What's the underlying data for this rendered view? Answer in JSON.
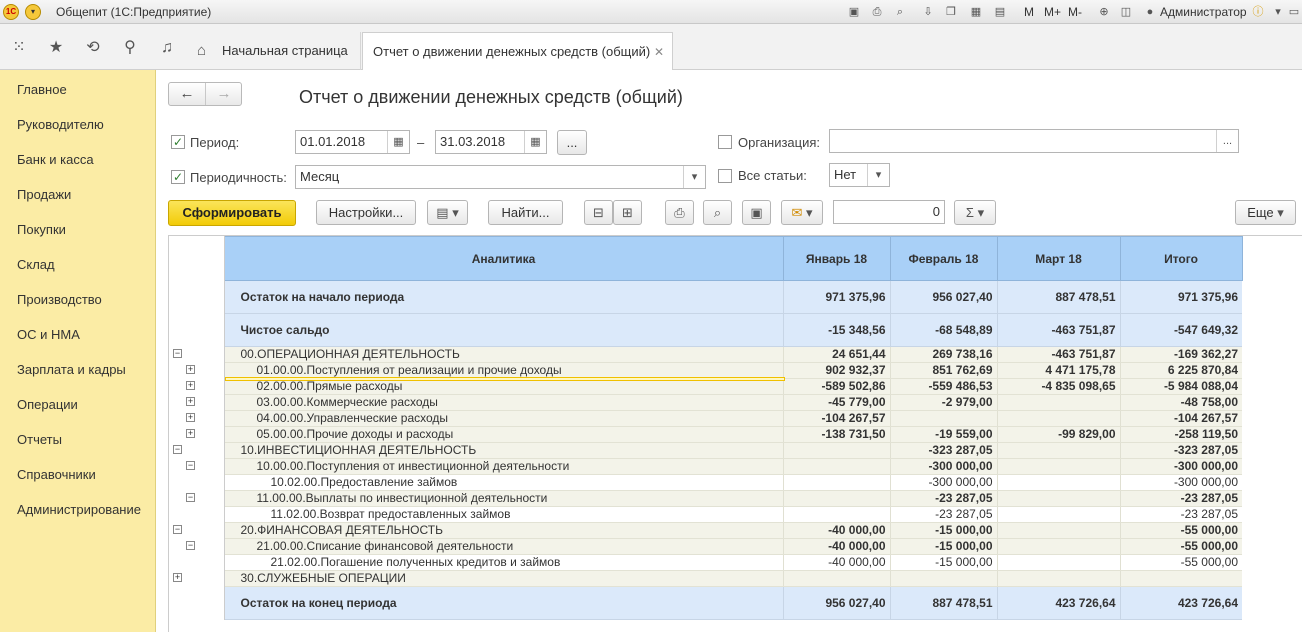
{
  "window": {
    "title": "Общепит  (1С:Предприятие)",
    "user": "Администратор",
    "toolbar_text": [
      "M",
      "M+",
      "M-"
    ]
  },
  "tabs": {
    "home": "Начальная страница",
    "active": "Отчет о движении денежных средств (общий)"
  },
  "sidebar": {
    "items": [
      "Главное",
      "Руководителю",
      "Банк и касса",
      "Продажи",
      "Покупки",
      "Склад",
      "Производство",
      "ОС и НМА",
      "Зарплата и кадры",
      "Операции",
      "Отчеты",
      "Справочники",
      "Администрирование"
    ]
  },
  "page": {
    "title": "Отчет о движении денежных средств (общий)"
  },
  "filters": {
    "period_label": "Период:",
    "period_from": "01.01.2018",
    "dash": "–",
    "period_to": "31.03.2018",
    "dots": "...",
    "periodicity_label": "Периодичность:",
    "periodicity_value": "Месяц",
    "org_label": "Организация:",
    "org_value": "",
    "all_items_label": "Все статьи:",
    "all_items_value": "Нет"
  },
  "buttons": {
    "generate": "Сформировать",
    "settings": "Настройки...",
    "find": "Найти...",
    "sum_value": "0",
    "more": "Еще"
  },
  "colors": {
    "sidebar_bg": "#fbeca5",
    "header_bg": "#a9d0f7",
    "total_bg": "#dbe9fa",
    "row_bg": "#f3f3e9",
    "generate_button": "#f2cb07"
  },
  "report": {
    "headers": [
      "Аналитика",
      "Январь 18",
      "Февраль 18",
      "Март 18",
      "Итого"
    ],
    "rows": [
      {
        "label": "Остаток на начало периода",
        "v": [
          "971 375,96",
          "956 027,40",
          "887 478,51",
          "971 375,96"
        ]
      },
      {
        "label": "Чистое сальдо",
        "v": [
          "-15 348,56",
          "-68 548,89",
          "-463 751,87",
          "-547 649,32"
        ]
      },
      {
        "label": "00.ОПЕРАЦИОННАЯ ДЕЯТЕЛЬНОСТЬ",
        "v": [
          "24 651,44",
          "269 738,16",
          "-463 751,87",
          "-169 362,27"
        ]
      },
      {
        "label": "01.00.00.Поступления от реализации и прочие доходы",
        "v": [
          "902 932,37",
          "851 762,69",
          "4 471 175,78",
          "6 225 870,84"
        ]
      },
      {
        "label": "02.00.00.Прямые расходы",
        "v": [
          "-589 502,86",
          "-559 486,53",
          "-4 835 098,65",
          "-5 984 088,04"
        ]
      },
      {
        "label": "03.00.00.Коммерческие расходы",
        "v": [
          "-45 779,00",
          "-2 979,00",
          "",
          "-48 758,00"
        ]
      },
      {
        "label": "04.00.00.Управленческие расходы",
        "v": [
          "-104 267,57",
          "",
          "",
          "-104 267,57"
        ]
      },
      {
        "label": "05.00.00.Прочие доходы и расходы",
        "v": [
          "-138 731,50",
          "-19 559,00",
          "-99 829,00",
          "-258 119,50"
        ]
      },
      {
        "label": "10.ИНВЕСТИЦИОННАЯ ДЕЯТЕЛЬНОСТЬ",
        "v": [
          "",
          "-323 287,05",
          "",
          "-323 287,05"
        ]
      },
      {
        "label": "10.00.00.Поступления от инвестиционной деятельности",
        "v": [
          "",
          "-300 000,00",
          "",
          "-300 000,00"
        ]
      },
      {
        "label": "10.02.00.Предоставление займов",
        "v": [
          "",
          "-300 000,00",
          "",
          "-300 000,00"
        ]
      },
      {
        "label": "11.00.00.Выплаты по инвестиционной деятельности",
        "v": [
          "",
          "-23 287,05",
          "",
          "-23 287,05"
        ]
      },
      {
        "label": "11.02.00.Возврат предоставленных займов",
        "v": [
          "",
          "-23 287,05",
          "",
          "-23 287,05"
        ]
      },
      {
        "label": "20.ФИНАНСОВАЯ ДЕЯТЕЛЬНОСТЬ",
        "v": [
          "-40 000,00",
          "-15 000,00",
          "",
          "-55 000,00"
        ]
      },
      {
        "label": "21.00.00.Списание финансовой деятельности",
        "v": [
          "-40 000,00",
          "-15 000,00",
          "",
          "-55 000,00"
        ]
      },
      {
        "label": "21.02.00.Погашение полученных кредитов и займов",
        "v": [
          "-40 000,00",
          "-15 000,00",
          "",
          "-55 000,00"
        ]
      },
      {
        "label": "30.СЛУЖЕБНЫЕ ОПЕРАЦИИ",
        "v": [
          "",
          "",
          "",
          ""
        ]
      },
      {
        "label": "Остаток на конец периода",
        "v": [
          "956 027,40",
          "887 478,51",
          "423 726,64",
          "423 726,64"
        ]
      }
    ]
  }
}
